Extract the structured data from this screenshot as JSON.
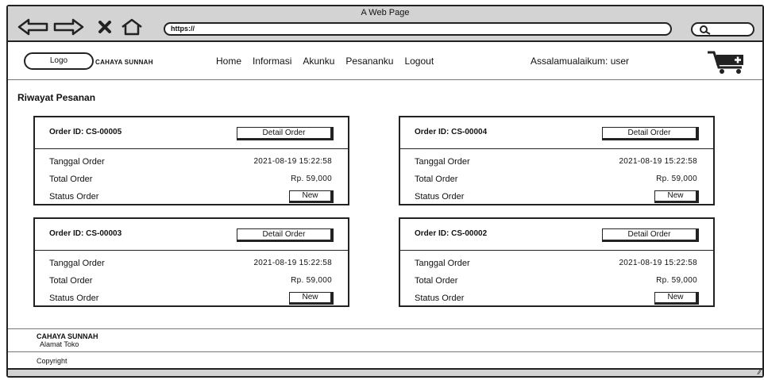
{
  "browser": {
    "title": "A Web Page",
    "url": "https://"
  },
  "nav": {
    "logo": "Logo",
    "brand": "CAHAYA SUNNAH",
    "links": [
      "Home",
      "Informasi",
      "Akunku",
      "Pesananku",
      "Logout"
    ],
    "greeting": "Assalamualaikum: user"
  },
  "main": {
    "title": "Riwayat Pesanan",
    "labels": {
      "date": "Tanggal Order",
      "total": "Total Order",
      "status": "Status Order",
      "detail_button": "Detail Order"
    },
    "orders": [
      {
        "id": "Order ID: CS-00005",
        "date": "2021-08-19 15:22:58",
        "total": "Rp. 59,000",
        "status": "New"
      },
      {
        "id": "Order ID: CS-00004",
        "date": "2021-08-19 15:22:58",
        "total": "Rp. 59,000",
        "status": "New"
      },
      {
        "id": "Order ID: CS-00003",
        "date": "2021-08-19 15:22:58",
        "total": "Rp. 59,000",
        "status": "New"
      },
      {
        "id": "Order ID: CS-00002",
        "date": "2021-08-19 15:22:58",
        "total": "Rp. 59,000",
        "status": "New"
      }
    ]
  },
  "footer": {
    "brand": "CAHAYA SUNNAH",
    "address": "Alamat Toko",
    "copyright": "Copyright"
  }
}
